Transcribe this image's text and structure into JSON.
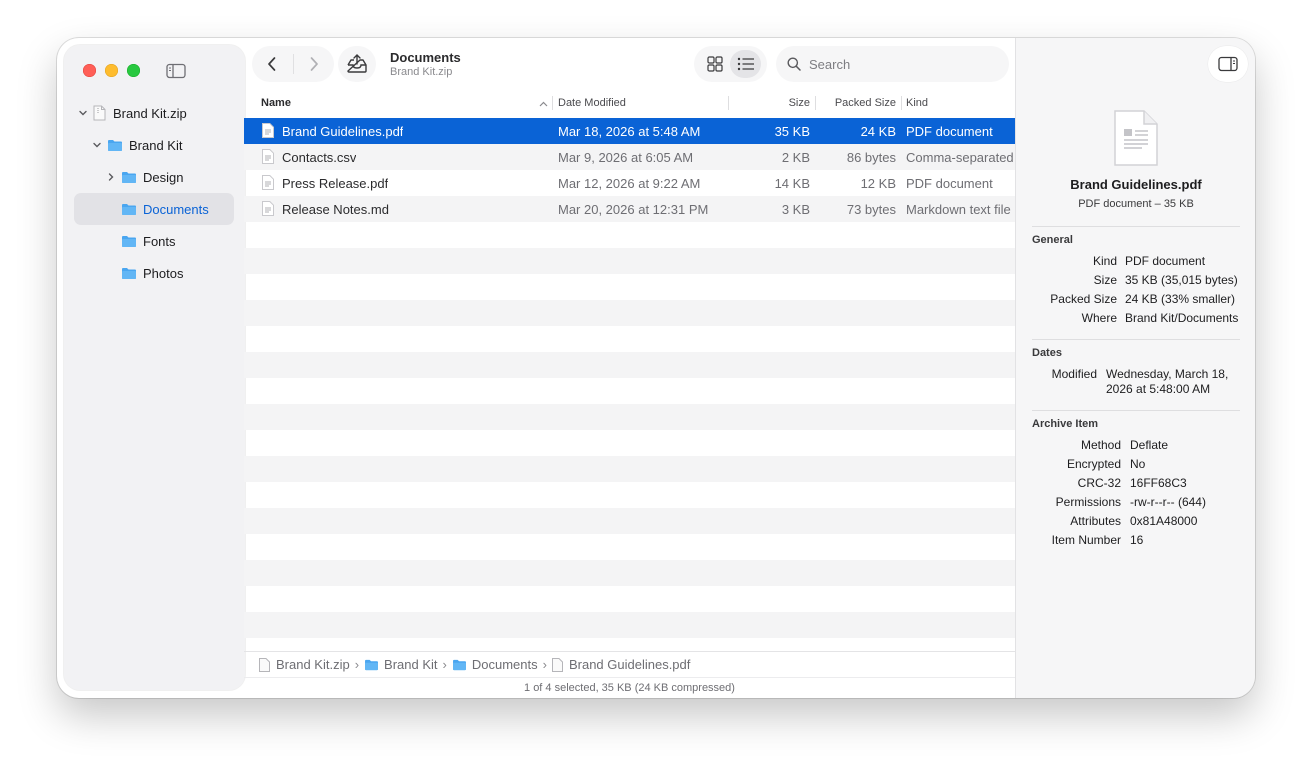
{
  "colors": {
    "accent": "#0a63d6",
    "folder": "#4aa6f0",
    "close": "#ff5f57",
    "minimize": "#febc2e",
    "zoom": "#28c840"
  },
  "sidebar": {
    "items": [
      {
        "label": "Brand Kit.zip",
        "icon": "zip-file-icon",
        "expanded": true
      },
      {
        "label": "Brand Kit",
        "icon": "folder-icon",
        "expanded": true
      },
      {
        "label": "Design",
        "icon": "folder-icon",
        "expanded": false
      },
      {
        "label": "Documents",
        "icon": "folder-icon",
        "selected": true
      },
      {
        "label": "Fonts",
        "icon": "folder-icon"
      },
      {
        "label": "Photos",
        "icon": "folder-icon"
      }
    ]
  },
  "toolbar": {
    "title": "Documents",
    "subtitle": "Brand Kit.zip",
    "search_placeholder": "Search",
    "view_mode": "list"
  },
  "table": {
    "headers": {
      "name": "Name",
      "date": "Date Modified",
      "size": "Size",
      "packed": "Packed Size",
      "kind": "Kind"
    },
    "sort": "name-ascending",
    "rows": [
      {
        "name": "Brand Guidelines.pdf",
        "date": "Mar 18, 2026 at 5:48 AM",
        "size": "35 KB",
        "packed": "24 KB",
        "kind": "PDF document",
        "selected": true
      },
      {
        "name": "Contacts.csv",
        "date": "Mar 9, 2026 at 6:05 AM",
        "size": "2 KB",
        "packed": "86 bytes",
        "kind": "Comma-separated"
      },
      {
        "name": "Press Release.pdf",
        "date": "Mar 12, 2026 at 9:22 AM",
        "size": "14 KB",
        "packed": "12 KB",
        "kind": "PDF document"
      },
      {
        "name": "Release Notes.md",
        "date": "Mar 20, 2026 at 12:31 PM",
        "size": "3 KB",
        "packed": "73 bytes",
        "kind": "Markdown text file"
      }
    ]
  },
  "pathbar": {
    "crumbs": [
      "Brand Kit.zip",
      "Brand Kit",
      "Documents",
      "Brand Guidelines.pdf"
    ]
  },
  "status": "1 of 4 selected, 35 KB (24 KB compressed)",
  "inspector": {
    "name": "Brand Guidelines.pdf",
    "subtitle": "PDF document – 35 KB",
    "general_title": "General",
    "general": [
      {
        "k": "Kind",
        "v": "PDF document"
      },
      {
        "k": "Size",
        "v": "35 KB (35,015 bytes)"
      },
      {
        "k": "Packed Size",
        "v": "24 KB (33% smaller)"
      },
      {
        "k": "Where",
        "v": "Brand Kit/Documents"
      }
    ],
    "dates_title": "Dates",
    "modified_label": "Modified",
    "modified_line1": "Wednesday, March 18,",
    "modified_line2": "2026 at 5:48:00 AM",
    "archive_title": "Archive Item",
    "archive": [
      {
        "k": "Method",
        "v": "Deflate"
      },
      {
        "k": "Encrypted",
        "v": "No"
      },
      {
        "k": "CRC-32",
        "v": "16FF68C3"
      },
      {
        "k": "Permissions",
        "v": "-rw-r--r-- (644)"
      },
      {
        "k": "Attributes",
        "v": "0x81A48000"
      },
      {
        "k": "Item Number",
        "v": "16"
      }
    ]
  }
}
